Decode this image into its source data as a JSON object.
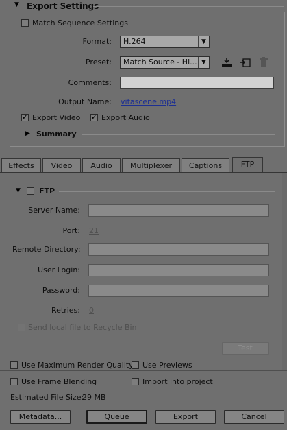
{
  "export_settings": {
    "title": "Export Settings",
    "match_sequence_label": "Match Sequence Settings",
    "match_sequence_checked": false,
    "format_label": "Format:",
    "format_value": "H.264",
    "preset_label": "Preset:",
    "preset_value": "Match Source - Hi...",
    "comments_label": "Comments:",
    "comments_value": "",
    "output_name_label": "Output Name:",
    "output_name_value": "vitascene.mp4",
    "export_video_label": "Export Video",
    "export_video_checked": true,
    "export_audio_label": "Export Audio",
    "export_audio_checked": true,
    "summary_label": "Summary",
    "icons": [
      "save-preset-icon",
      "import-preset-icon",
      "delete-preset-icon"
    ]
  },
  "tabs": [
    {
      "label": "Effects",
      "active": false
    },
    {
      "label": "Video",
      "active": false
    },
    {
      "label": "Audio",
      "active": false
    },
    {
      "label": "Multiplexer",
      "active": false
    },
    {
      "label": "Captions",
      "active": false
    },
    {
      "label": "FTP",
      "active": true
    }
  ],
  "ftp": {
    "title": "FTP",
    "enabled": false,
    "server_name_label": "Server Name:",
    "server_name_value": "",
    "port_label": "Port:",
    "port_value": "21",
    "remote_directory_label": "Remote Directory:",
    "remote_directory_value": "",
    "user_login_label": "User Login:",
    "user_login_value": "",
    "password_label": "Password:",
    "password_value": "",
    "retries_label": "Retries:",
    "retries_value": "0",
    "recycle_label": "Send local file to Recycle Bin",
    "test_button": "Test"
  },
  "bottom": {
    "max_render_quality": "Use Maximum Render Quality",
    "use_previews": "Use Previews",
    "frame_blending": "Use Frame Blending",
    "import_into_project": "Import into project",
    "file_size_label": "Estimated File Size:",
    "file_size_value": "29 MB",
    "metadata_button": "Metadata...",
    "queue_button": "Queue",
    "export_button": "Export",
    "cancel_button": "Cancel"
  }
}
